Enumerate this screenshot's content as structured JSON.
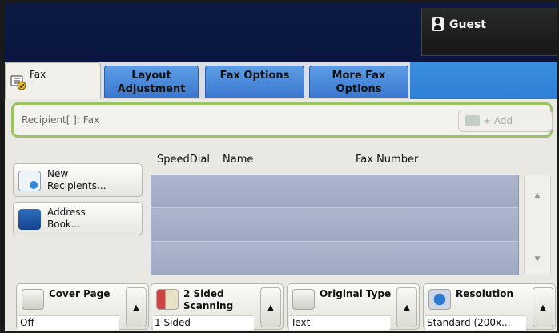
{
  "header": {
    "user_label": "Guest"
  },
  "tabs": [
    {
      "label": "Fax",
      "active": true
    },
    {
      "label_line1": "Layout",
      "label_line2": "Adjustment"
    },
    {
      "label": "Fax Options"
    },
    {
      "label_line1": "More Fax",
      "label_line2": "Options"
    }
  ],
  "recipient": {
    "label": "Recipient[   ]: Fax",
    "add_label": "+ Add"
  },
  "side_buttons": [
    {
      "line1": "New",
      "line2": "Recipients..."
    },
    {
      "line1": "Address",
      "line2": "Book..."
    }
  ],
  "list": {
    "columns": [
      "SpeedDial",
      "Name",
      "Fax Number"
    ],
    "rows": [],
    "scroll_up": "▲",
    "scroll_down": "▼"
  },
  "options": [
    {
      "title": "Cover Page",
      "value": "Off"
    },
    {
      "title_line1": "2 Sided",
      "title_line2": "Scanning",
      "value": "1 Sided"
    },
    {
      "title": "Original Type",
      "value": "Text"
    },
    {
      "title": "Resolution",
      "value": "Standard (200x..."
    }
  ],
  "colors": {
    "header_bg": "#0a1640",
    "tab_blue": "#3978cf",
    "recipient_border": "#9bc463",
    "list_bg": "#a9b1c9"
  }
}
